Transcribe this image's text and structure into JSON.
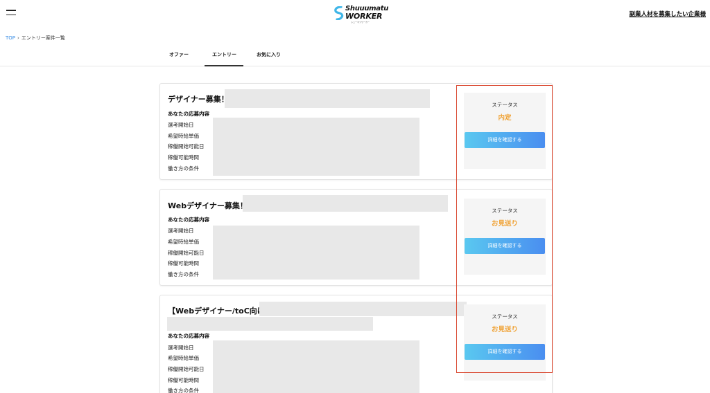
{
  "header": {
    "logo_top": "Shuuumatu",
    "logo_main": "WORKER",
    "logo_sub": "シューマツワーカー",
    "employer_link": "副業人材を募集したい企業様"
  },
  "breadcrumb": {
    "top": "TOP",
    "separator": "›",
    "current": "エントリー案件一覧"
  },
  "tabs": [
    {
      "label": "オファー",
      "active": false
    },
    {
      "label": "エントリー",
      "active": true
    },
    {
      "label": "お気に入り",
      "active": false
    }
  ],
  "entries": [
    {
      "title": "デザイナー募集！",
      "section_label": "あなたの応募内容",
      "fields": [
        "選考開始日",
        "希望時給単価",
        "稼働開始可能日",
        "稼働可能時間",
        "働き方の条件"
      ],
      "status_label": "ステータス",
      "status_value": "内定",
      "button_label": "詳細を確認する"
    },
    {
      "title": "Webデザイナー募集！",
      "section_label": "あなたの応募内容",
      "fields": [
        "選考開始日",
        "希望時給単価",
        "稼働開始可能日",
        "稼働可能時間",
        "働き方の条件"
      ],
      "status_label": "ステータス",
      "status_value": "お見送り",
      "button_label": "詳細を確認する"
    },
    {
      "title": "【Webデザイナー/toC向け",
      "section_label": "あなたの応募内容",
      "fields": [
        "選考開始日",
        "希望時給単価",
        "稼働開始可能日",
        "稼働可能時間",
        "働き方の条件"
      ],
      "status_label": "ステータス",
      "status_value": "お見送り",
      "button_label": "詳細を確認する"
    }
  ],
  "colors": {
    "status_accent": "#f0a030",
    "link": "#3a8ee6",
    "highlight_border": "#d9472f",
    "button_gradient_start": "#5ac8f0",
    "button_gradient_end": "#4a8ef0"
  }
}
